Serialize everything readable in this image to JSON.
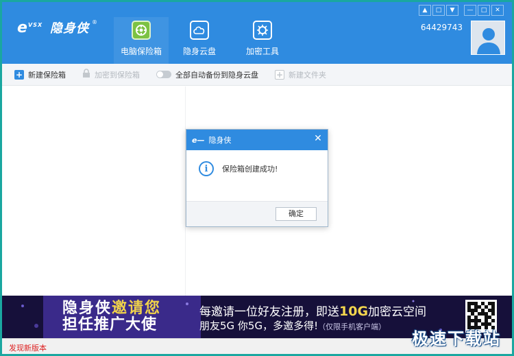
{
  "app": {
    "brand_mark": "e",
    "brand_mark_sub": "VSX",
    "brand_name": "隐身侠",
    "brand_reg": "®"
  },
  "nav": {
    "tabs": [
      {
        "label": "电脑保险箱",
        "icon": "safe-icon",
        "active": true
      },
      {
        "label": "隐身云盘",
        "icon": "cloud-icon",
        "active": false
      },
      {
        "label": "加密工具",
        "icon": "encrypt-tool-icon",
        "active": false
      }
    ]
  },
  "window_controls": [
    "skin-icon",
    "message-icon",
    "menu-icon",
    "minimize-icon",
    "maximize-icon",
    "close-icon"
  ],
  "user": {
    "id": "64429743"
  },
  "toolbar": {
    "new_safe": "新建保险箱",
    "encrypt_to_safe": "加密到保险箱",
    "auto_backup": "全部自动备份到隐身云盘",
    "new_folder": "新建文件夹",
    "auto_backup_on": false
  },
  "banner": {
    "promo_line1_a": "隐身侠",
    "promo_line1_b": "邀请您",
    "promo_line2": "担任推广大使",
    "line1_prefix": "每邀请一位好友注册，即送",
    "line1_accent": "10G",
    "line1_suffix": "加密云空间",
    "line2_main": "朋友5G  你5G，多邀多得!",
    "line2_small": "（仅限手机客户端）"
  },
  "status": {
    "new_version": "发现新版本",
    "watermark": "极速下载站"
  },
  "dialog": {
    "title": "隐身侠",
    "message": "保险箱创建成功!",
    "ok": "确定"
  },
  "colors": {
    "header_blue": "#2f8be0",
    "active_tab_icon": "#7cc243",
    "frame_teal": "#1aa7a0",
    "banner_bg": "#16103a",
    "banner_accent": "#f3d64e",
    "status_red": "#dd2222"
  }
}
